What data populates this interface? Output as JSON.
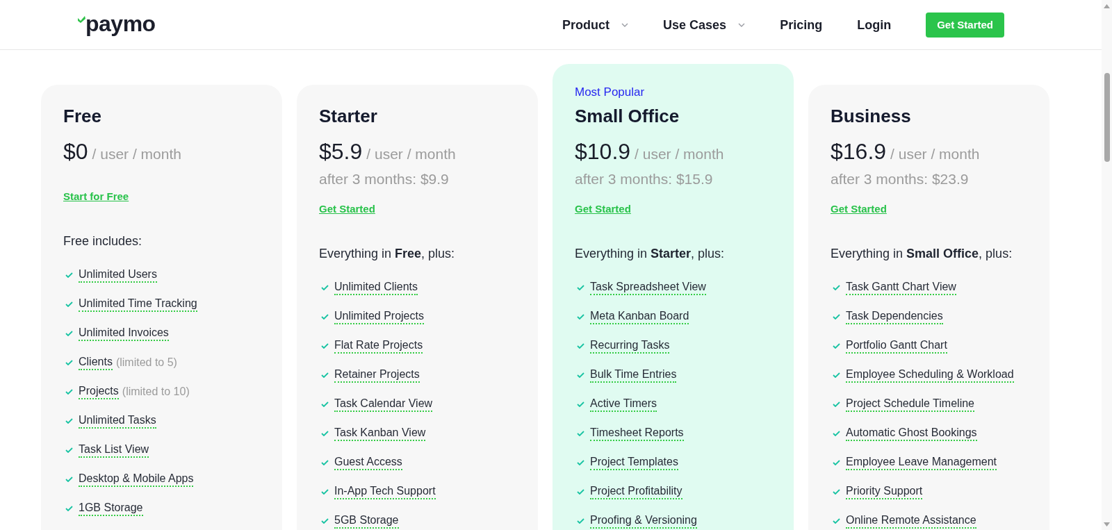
{
  "header": {
    "logo": "paymo",
    "nav": [
      {
        "label": "Product",
        "dropdown": true
      },
      {
        "label": "Use Cases",
        "dropdown": true
      },
      {
        "label": "Pricing",
        "dropdown": false
      },
      {
        "label": "Login",
        "dropdown": false
      }
    ],
    "cta": "Get Started"
  },
  "plans": [
    {
      "name": "Free",
      "highlighted": false,
      "price": "$0",
      "unit": "/ user / month",
      "cta": "Start for Free",
      "intro": "Free includes:",
      "features": [
        {
          "label": "Unlimited Users"
        },
        {
          "label": "Unlimited Time Tracking"
        },
        {
          "label": "Unlimited Invoices"
        },
        {
          "label": "Clients",
          "note": "(limited to 5)"
        },
        {
          "label": "Projects",
          "note": "(limited to 10)"
        },
        {
          "label": "Unlimited Tasks"
        },
        {
          "label": "Task List View"
        },
        {
          "label": "Desktop & Mobile Apps"
        },
        {
          "label": "1GB Storage"
        }
      ]
    },
    {
      "name": "Starter",
      "highlighted": false,
      "price": "$5.9",
      "unit": "/ user / month",
      "after": "after 3 months: $9.9",
      "cta": "Get Started",
      "intro": "Everything in **Free**, plus:",
      "features": [
        {
          "label": "Unlimited Clients"
        },
        {
          "label": "Unlimited Projects"
        },
        {
          "label": "Flat Rate Projects"
        },
        {
          "label": "Retainer Projects"
        },
        {
          "label": "Task Calendar View"
        },
        {
          "label": "Task Kanban View"
        },
        {
          "label": "Guest Access"
        },
        {
          "label": "In-App Tech Support"
        },
        {
          "label": "5GB Storage"
        }
      ]
    },
    {
      "badge": "Most Popular",
      "name": "Small Office",
      "highlighted": true,
      "price": "$10.9",
      "unit": "/ user / month",
      "after": "after 3 months: $15.9",
      "cta": "Get Started",
      "intro": "Everything in **Starter**, plus:",
      "features": [
        {
          "label": "Task Spreadsheet View"
        },
        {
          "label": "Meta Kanban Board"
        },
        {
          "label": "Recurring Tasks"
        },
        {
          "label": "Bulk Time Entries"
        },
        {
          "label": "Active Timers"
        },
        {
          "label": "Timesheet Reports"
        },
        {
          "label": "Project Templates"
        },
        {
          "label": "Project Profitability"
        },
        {
          "label": "Proofing & Versioning"
        }
      ]
    },
    {
      "name": "Business",
      "highlighted": false,
      "price": "$16.9",
      "unit": "/ user / month",
      "after": "after 3 months: $23.9",
      "cta": "Get Started",
      "intro": "Everything in **Small Office**, plus:",
      "features": [
        {
          "label": "Task Gantt Chart View"
        },
        {
          "label": "Task Dependencies"
        },
        {
          "label": "Portfolio Gantt Chart"
        },
        {
          "label": "Employee Scheduling & Workload"
        },
        {
          "label": "Project Schedule Timeline"
        },
        {
          "label": "Automatic Ghost Bookings"
        },
        {
          "label": "Employee Leave Management"
        },
        {
          "label": "Priority Support"
        },
        {
          "label": "Online Remote Assistance"
        }
      ]
    }
  ]
}
